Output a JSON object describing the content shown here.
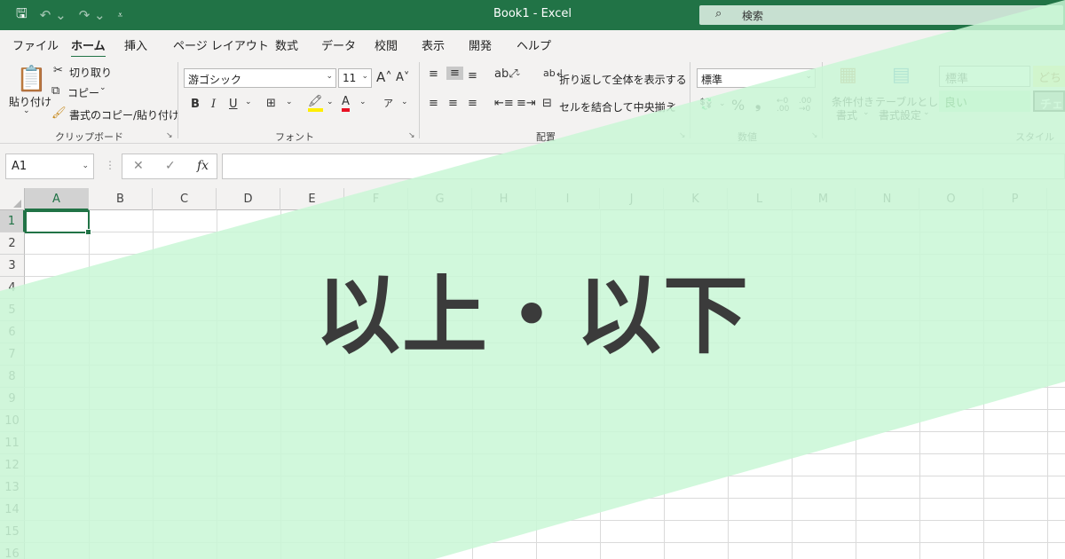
{
  "titlebar": {
    "title": "Book1  -  Excel",
    "search_placeholder": "検索",
    "search_icon": "search-icon",
    "background": "#217346"
  },
  "menu": {
    "tabs": [
      "ファイル",
      "ホーム",
      "挿入",
      "ページ レイアウト",
      "数式",
      "データ",
      "校閲",
      "表示",
      "開発",
      "ヘルプ"
    ],
    "active_tab": "ホーム"
  },
  "ribbon": {
    "clipboard": {
      "label": "クリップボード",
      "paste": "貼り付け",
      "cut": "切り取り",
      "copy": "コピー",
      "format_painter": "書式のコピー/貼り付け"
    },
    "font": {
      "label": "フォント",
      "font_name": "游ゴシック",
      "font_size": "11",
      "bold": "B",
      "italic": "I",
      "underline": "U",
      "font_color_glyph": "A",
      "phonetic_glyph": "ア"
    },
    "alignment": {
      "label": "配置",
      "wrap_text": "折り返して全体を表示する",
      "merge_center": "セルを結合して中央揃え"
    },
    "number": {
      "label": "数値",
      "format": "標準",
      "percent": "%",
      "comma": "❟",
      "increase_decimal": "←0 .00",
      "decrease_decimal": ".00 →0"
    },
    "styles": {
      "label": "スタイル",
      "conditional_format_line1": "条件付き",
      "conditional_format_line2": "書式",
      "format_as_table_line1": "テーブルとして",
      "format_as_table_line2": "書式設定",
      "cell_styles": [
        "標準",
        "どち",
        "良い",
        "チェ"
      ]
    }
  },
  "formula_bar": {
    "name_box": "A1",
    "cancel": "✕",
    "enter": "✓",
    "fx": "fx",
    "value": ""
  },
  "sheet": {
    "columns": [
      "A",
      "B",
      "C",
      "D",
      "E",
      "F",
      "G",
      "H",
      "I",
      "J",
      "K",
      "L",
      "M",
      "N",
      "O",
      "P"
    ],
    "rows": [
      "1",
      "2",
      "3",
      "4",
      "5",
      "6",
      "7",
      "8",
      "9",
      "10",
      "11",
      "12",
      "13",
      "14",
      "15",
      "16"
    ],
    "active_cell": "A1"
  },
  "banner": {
    "headline": "以上・以下",
    "band_color": "#c9f7d6"
  }
}
